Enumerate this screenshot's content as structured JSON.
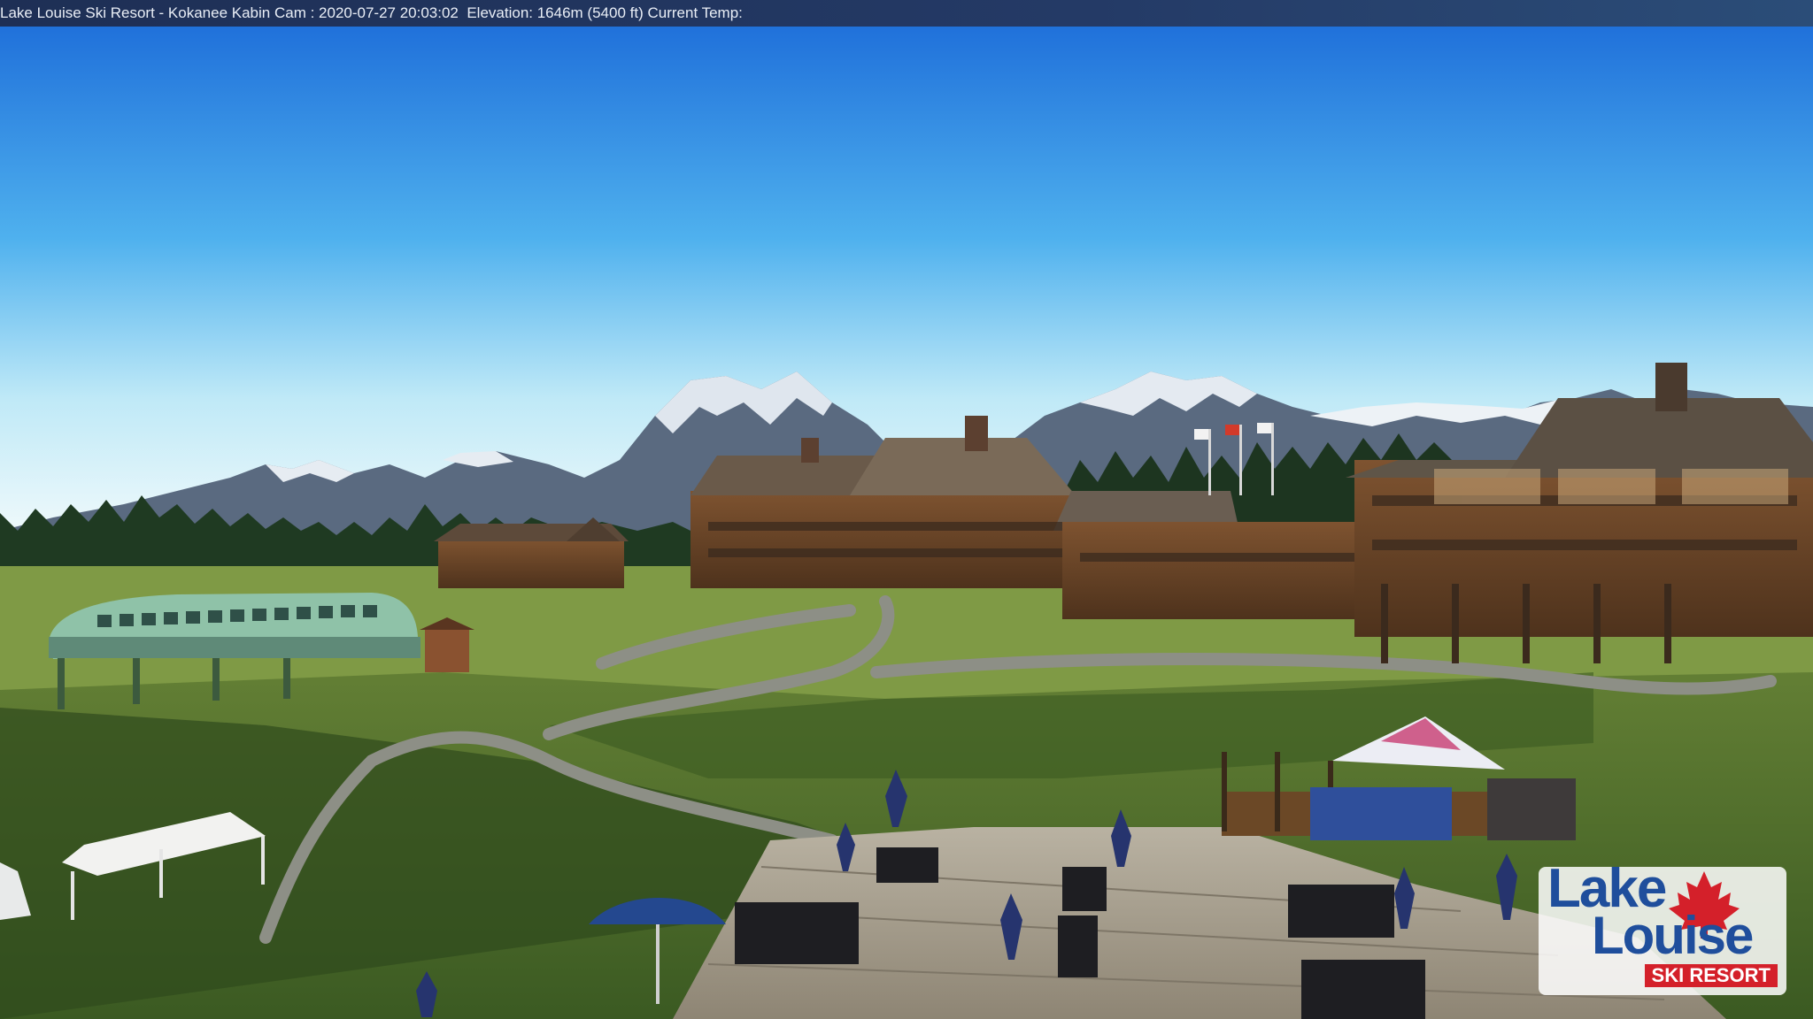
{
  "caption": {
    "resort": "Lake Louise Ski Resort - Kokanee Kabin Cam",
    "separator": " : ",
    "timestamp": "2020-07-27 20:03:02",
    "elevation": "Elevation: 1646m (5400 ft)",
    "temp": "Current Temp:"
  },
  "logo": {
    "line1": "Lake",
    "line2": "Louise",
    "line3": "SKI RESORT"
  },
  "colors": {
    "sky_top": "#1c6ddb",
    "sky_horizon": "#e8f7fb",
    "grass": "#4c6b2a",
    "lodge": "#6a4526",
    "logo_blue": "#1f4e9c",
    "logo_red": "#d4202a"
  }
}
